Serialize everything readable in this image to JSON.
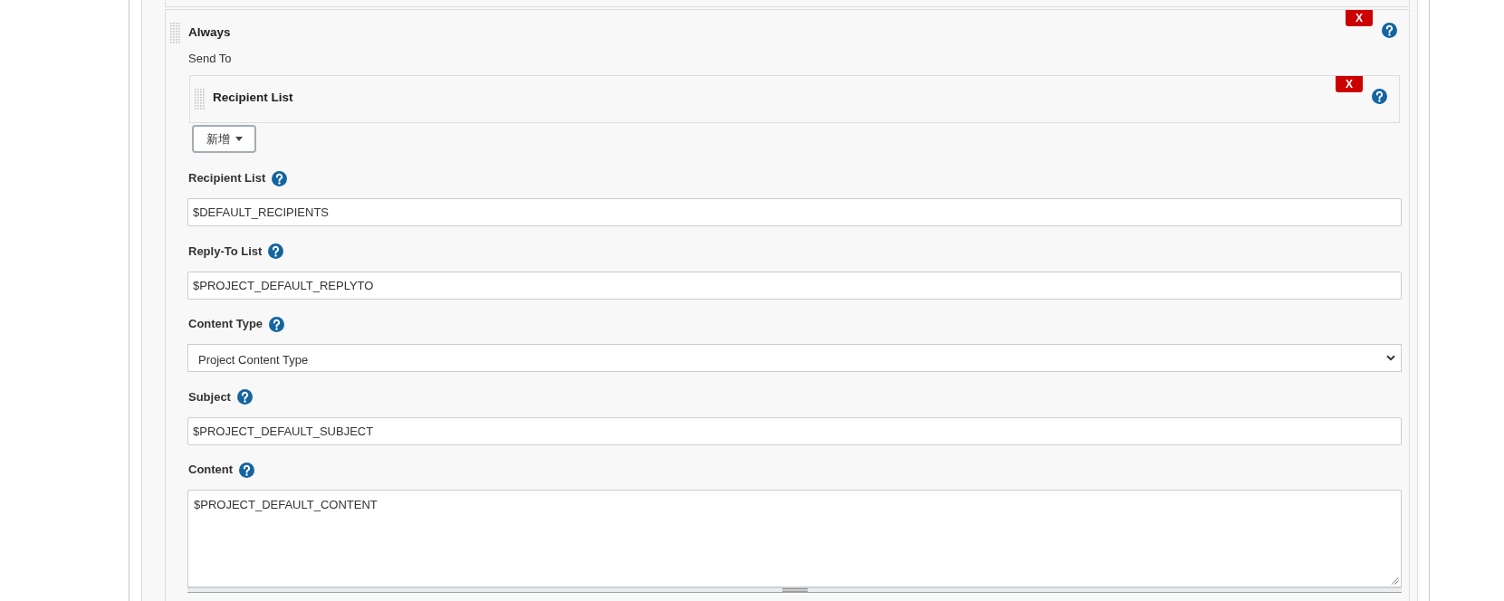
{
  "section": {
    "title": "Always",
    "delete_button": "X",
    "send_to": {
      "label": "Send To",
      "recipient_providers": [
        {
          "title": "Recipient List",
          "delete_button": "X"
        }
      ],
      "add_button": {
        "label": "新增"
      }
    },
    "fields": [
      {
        "kind": "input",
        "label": "Recipient List",
        "value": "$DEFAULT_RECIPIENTS"
      },
      {
        "kind": "input",
        "label": "Reply-To List",
        "value": "$PROJECT_DEFAULT_REPLYTO"
      },
      {
        "kind": "select",
        "label": "Content Type",
        "value": "Project Content Type"
      },
      {
        "kind": "input",
        "label": "Subject",
        "value": "$PROJECT_DEFAULT_SUBJECT"
      },
      {
        "kind": "textarea",
        "label": "Content",
        "value": "$PROJECT_DEFAULT_CONTENT"
      }
    ]
  }
}
